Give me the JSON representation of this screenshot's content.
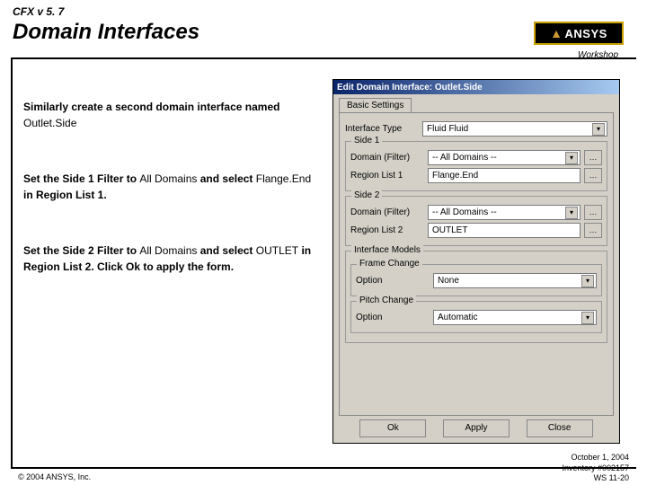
{
  "header": {
    "version": "CFX v 5. 7",
    "title": "Domain Interfaces",
    "logo": "ANSYS",
    "workshop": "Workshop"
  },
  "body": {
    "p1a": "Similarly create a second domain interface named ",
    "p1b": "Outlet.Side",
    "p2a": "Set the Side 1 Filter to ",
    "p2b": "All Domains",
    "p2c": " and select ",
    "p2d": "Flange.End",
    "p2e": " in Region List 1.",
    "p3a": "Set the Side 2 Filter to ",
    "p3b": "All Domains",
    "p3c": " and select ",
    "p3d": "OUTLET",
    "p3e": " in Region List 2. Click Ok to apply the form."
  },
  "dialog": {
    "title": "Edit Domain Interface: Outlet.Side",
    "tab": "Basic Settings",
    "labels": {
      "ifaceType": "Interface Type",
      "side1": "Side 1",
      "side2": "Side 2",
      "domainFilter": "Domain (Filter)",
      "regionList1": "Region List 1",
      "regionList2": "Region List 2",
      "ifaceModels": "Interface Models",
      "frameChange": "Frame Change",
      "pitchChange": "Pitch Change",
      "option": "Option"
    },
    "values": {
      "ifaceType": "Fluid Fluid",
      "domainFilter": "-- All Domains --",
      "regionList1": "Flange.End",
      "regionList2": "OUTLET",
      "frameChange": "None",
      "pitchChange": "Automatic"
    },
    "buttons": {
      "ok": "Ok",
      "apply": "Apply",
      "close": "Close",
      "ellipsis": "…"
    }
  },
  "footer": {
    "copyright": "© 2004 ANSYS, Inc.",
    "date": "October 1, 2004",
    "inventory": "Inventory #002157",
    "page": "WS 11-20"
  }
}
